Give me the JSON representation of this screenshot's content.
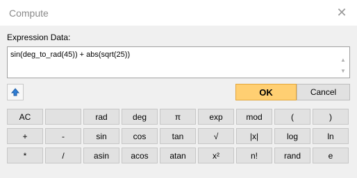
{
  "window": {
    "title": "Compute"
  },
  "expression": {
    "label": "Expression Data:",
    "value": "sin(deg_to_rad(45)) + abs(sqrt(25))"
  },
  "actions": {
    "ok": "OK",
    "cancel": "Cancel"
  },
  "keys": {
    "row1": [
      "AC",
      "",
      "rad",
      "deg",
      "π",
      "exp",
      "mod",
      "(",
      ")"
    ],
    "row2": [
      "+",
      "-",
      "sin",
      "cos",
      "tan",
      "√",
      "|x|",
      "log",
      "ln"
    ],
    "row3": [
      "*",
      "/",
      "asin",
      "acos",
      "atan",
      "x²",
      "n!",
      "rand",
      "e"
    ]
  },
  "colors": {
    "ok_bg": "#ffcf72",
    "ok_border": "#e3a63b",
    "window_bg": "#f0f0f0"
  },
  "icons": {
    "close": "close-icon",
    "toggle": "arrow-up-icon"
  }
}
